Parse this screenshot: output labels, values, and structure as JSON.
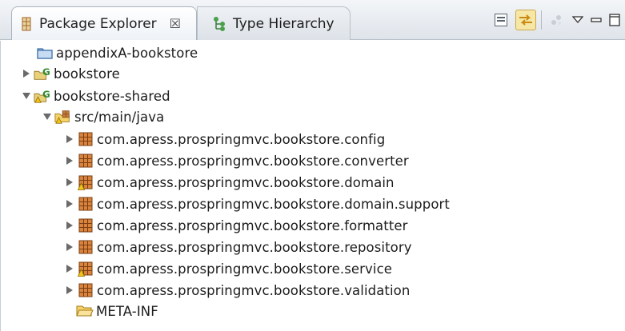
{
  "tabs": [
    {
      "label": "Package Explorer",
      "active": true,
      "close_glyph": "☒"
    },
    {
      "label": "Type Hierarchy",
      "active": false
    }
  ],
  "toolbar": {
    "buttons": [
      "collapse-all-icon",
      "link-with-editor-icon",
      "focus-icon",
      "view-menu-icon",
      "minimize-icon",
      "maximize-icon"
    ]
  },
  "tree": {
    "items": [
      {
        "label": "appendixA-bookstore",
        "icon": "project-folder-icon",
        "expanded": null
      },
      {
        "label": "bookstore",
        "icon": "gradle-project-icon",
        "expanded": false
      },
      {
        "label": "bookstore-shared",
        "icon": "gradle-project-warning-icon",
        "expanded": true
      },
      {
        "label": "src/main/java",
        "icon": "source-folder-warning-icon",
        "expanded": true
      },
      {
        "label": "com.apress.prospringmvc.bookstore.config",
        "icon": "package-icon",
        "expanded": false
      },
      {
        "label": "com.apress.prospringmvc.bookstore.converter",
        "icon": "package-icon",
        "expanded": false
      },
      {
        "label": "com.apress.prospringmvc.bookstore.domain",
        "icon": "package-warning-icon",
        "expanded": false
      },
      {
        "label": "com.apress.prospringmvc.bookstore.domain.support",
        "icon": "package-icon",
        "expanded": false
      },
      {
        "label": "com.apress.prospringmvc.bookstore.formatter",
        "icon": "package-icon",
        "expanded": false
      },
      {
        "label": "com.apress.prospringmvc.bookstore.repository",
        "icon": "package-icon",
        "expanded": false
      },
      {
        "label": "com.apress.prospringmvc.bookstore.service",
        "icon": "package-warning-icon",
        "expanded": false
      },
      {
        "label": "com.apress.prospringmvc.bookstore.validation",
        "icon": "package-icon",
        "expanded": false
      },
      {
        "label": "META-INF",
        "icon": "folder-icon",
        "expanded": null
      }
    ]
  },
  "colors": {
    "package_brown": "#a0622c",
    "gradle_green": "#2f8a2f",
    "warning_yellow": "#f2c318",
    "folder_yellow": "#f4d26a",
    "selection_yellow": "#f6e7a6"
  }
}
